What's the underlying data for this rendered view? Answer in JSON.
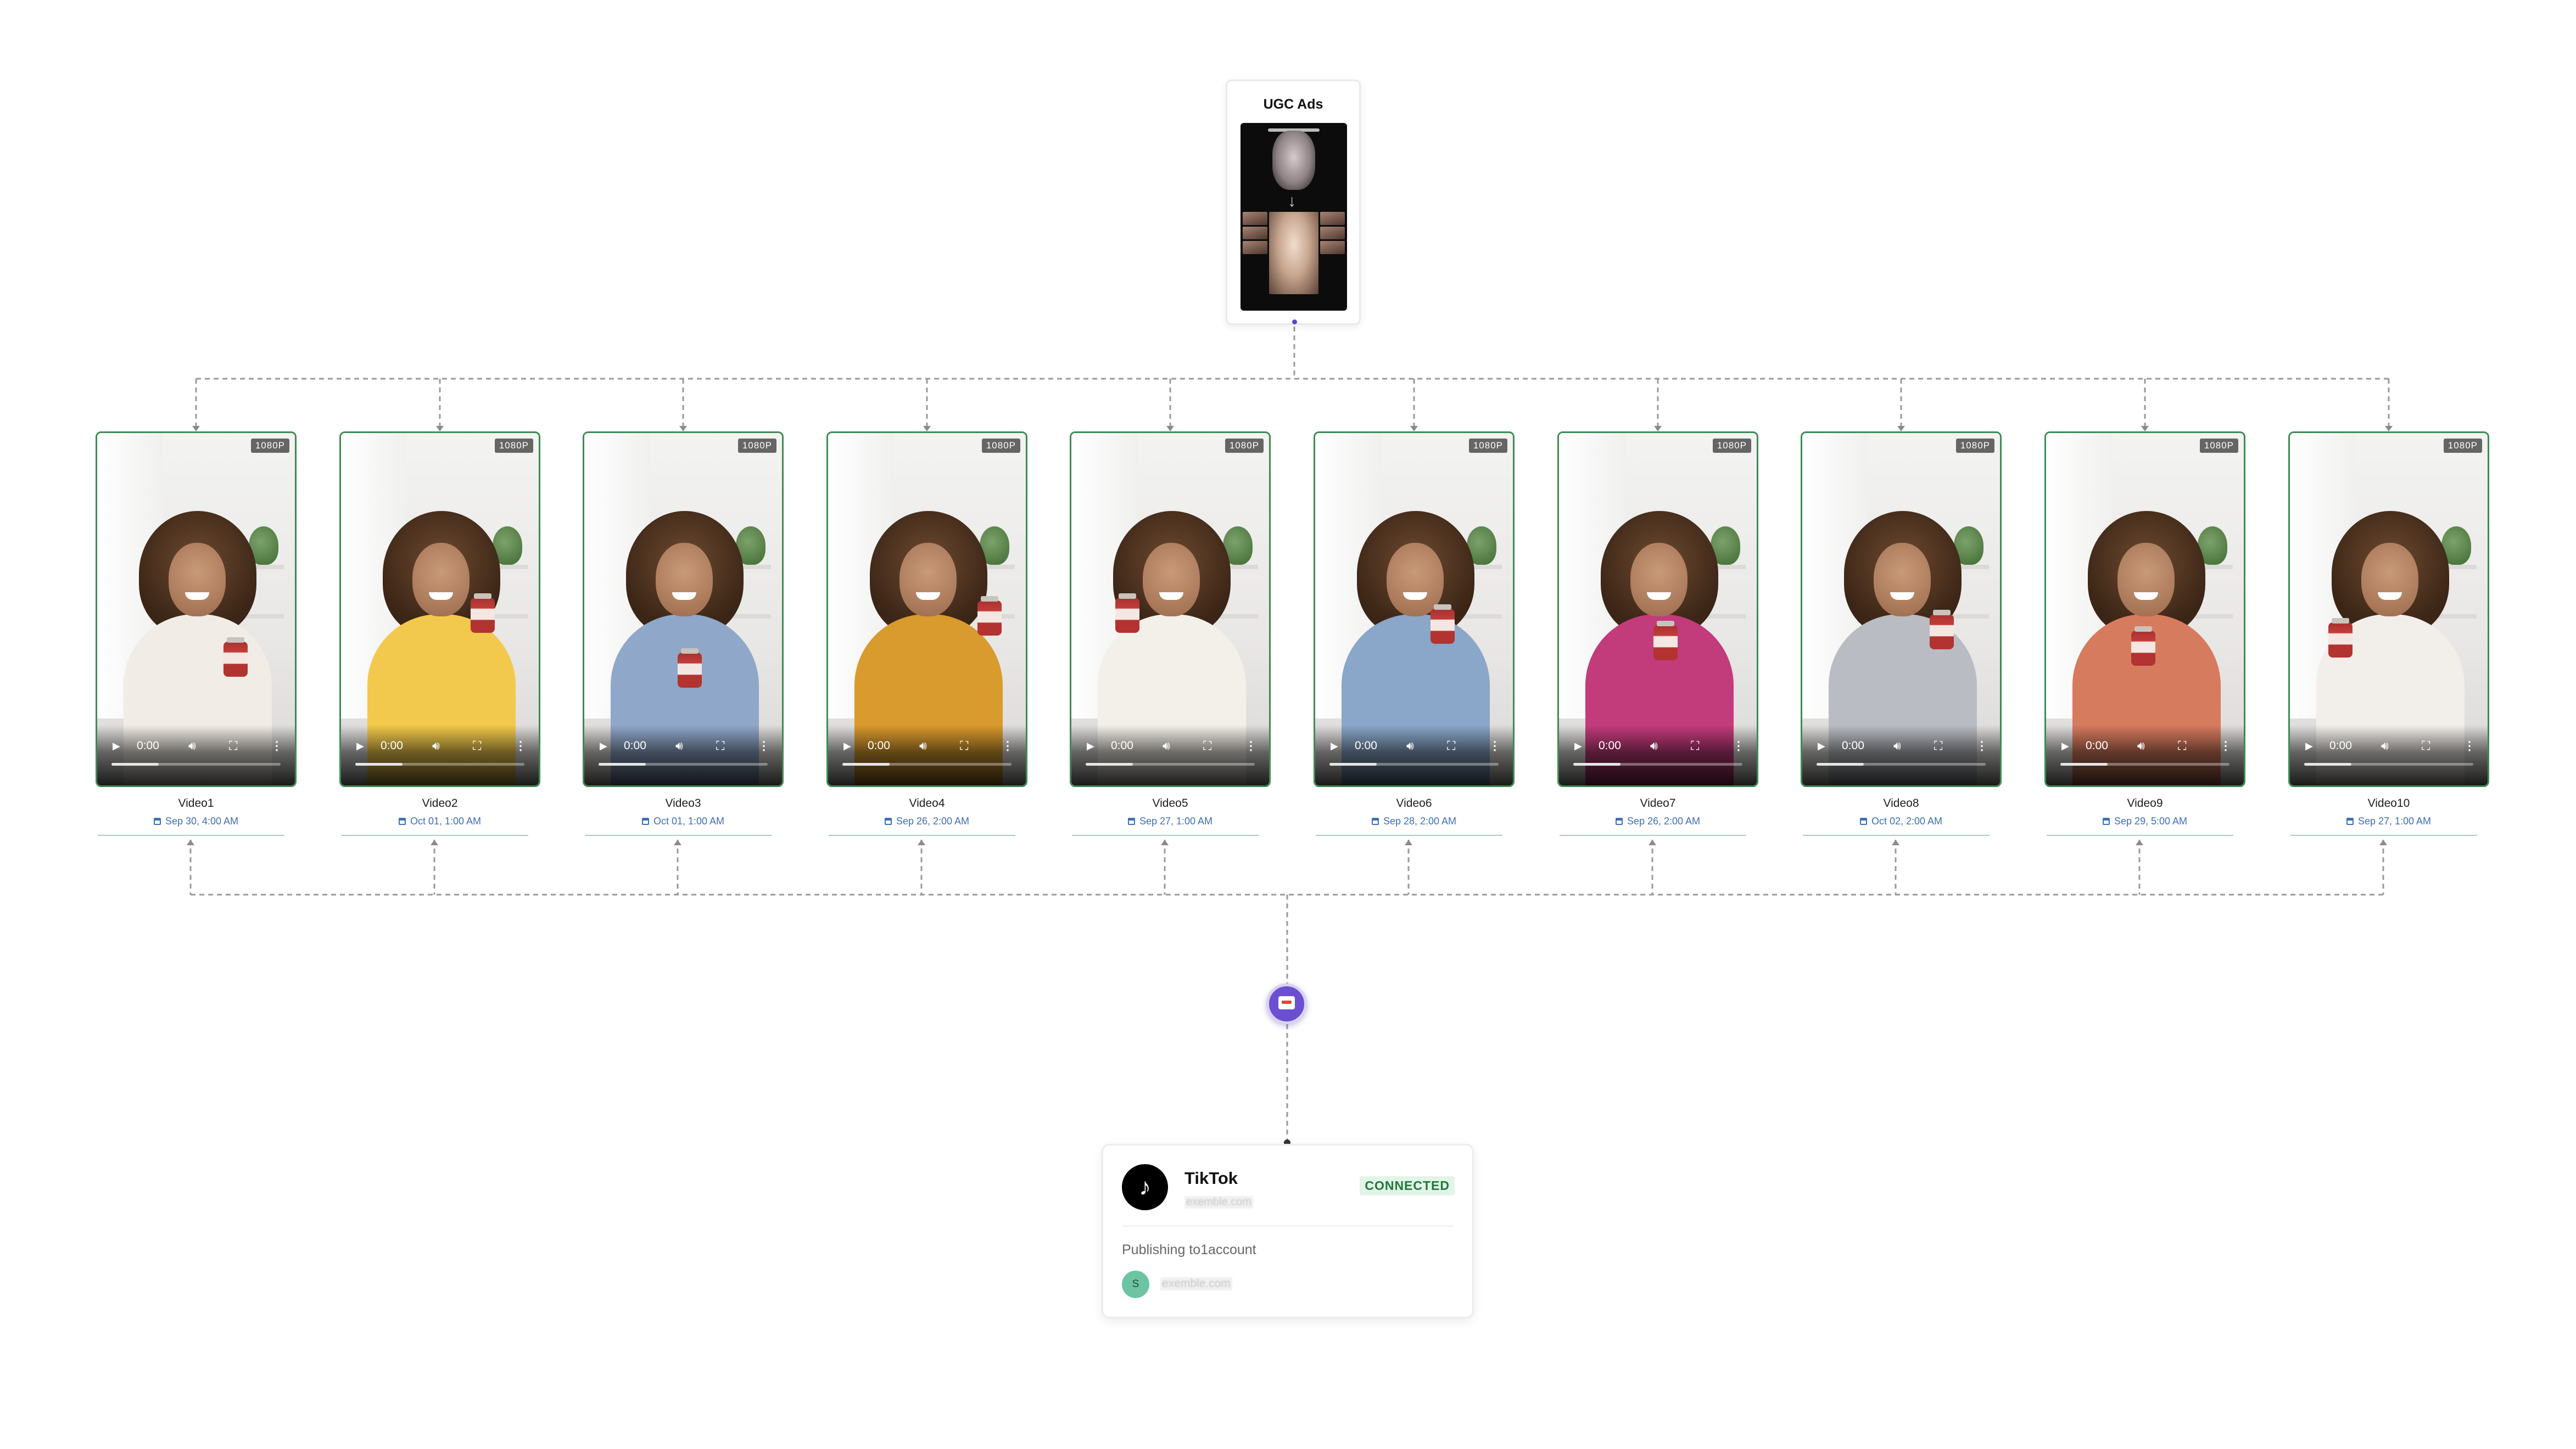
{
  "source": {
    "title": "UGC Ads"
  },
  "videos": [
    {
      "title": "Video1",
      "badge": "1080P",
      "time": "0:00",
      "date": "Sep 30, 4:00 AM"
    },
    {
      "title": "Video2",
      "badge": "1080P",
      "time": "0:00",
      "date": "Oct 01, 1:00 AM"
    },
    {
      "title": "Video3",
      "badge": "1080P",
      "time": "0:00",
      "date": "Oct 01, 1:00 AM"
    },
    {
      "title": "Video4",
      "badge": "1080P",
      "time": "0:00",
      "date": "Sep 26, 2:00 AM"
    },
    {
      "title": "Video5",
      "badge": "1080P",
      "time": "0:00",
      "date": "Sep 27, 1:00 AM"
    },
    {
      "title": "Video6",
      "badge": "1080P",
      "time": "0:00",
      "date": "Sep 28, 2:00 AM"
    },
    {
      "title": "Video7",
      "badge": "1080P",
      "time": "0:00",
      "date": "Sep 26, 2:00 AM"
    },
    {
      "title": "Video8",
      "badge": "1080P",
      "time": "0:00",
      "date": "Oct 02, 2:00 AM"
    },
    {
      "title": "Video9",
      "badge": "1080P",
      "time": "0:00",
      "date": "Sep 29, 5:00 AM"
    },
    {
      "title": "Video10",
      "badge": "1080P",
      "time": "0:00",
      "date": "Sep 27, 1:00 AM"
    }
  ],
  "icons": {
    "play": "play-icon",
    "volume": "volume-icon",
    "fullscreen": "fullscreen-icon",
    "menu": "more-vertical-icon",
    "calendar": "calendar-icon",
    "hub": "inbox-tray-icon",
    "tiktok": "tiktok-logo-icon"
  },
  "destination": {
    "platform": "TikTok",
    "subtitle": "exemble.com",
    "status": "CONNECTED",
    "publishing": "Publishing to1account",
    "account_initial": "S",
    "account_name": "exemble.com"
  },
  "colors": {
    "card_border": "#3f8a55",
    "date_text": "#3d6fb6",
    "hub": "#6b4fd0",
    "connected_bg": "#e2f4e7",
    "connected_text": "#1f7a3a",
    "avatar": "#6cc4a2"
  }
}
